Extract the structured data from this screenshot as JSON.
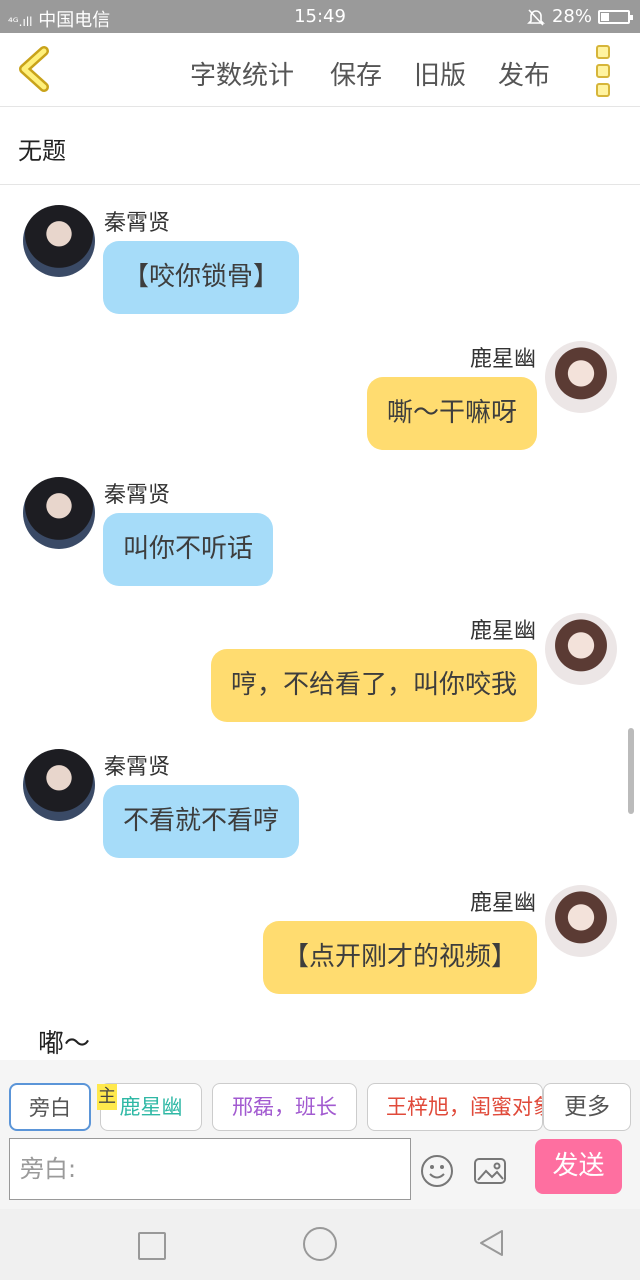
{
  "status_bar": {
    "carrier": "中国电信",
    "signal": "⁴ᴳ.ıll",
    "time": "15:49",
    "battery": "28%"
  },
  "toolbar": {
    "word_count": "字数统计",
    "save": "保存",
    "old_version": "旧版",
    "publish": "发布"
  },
  "title": "无题",
  "messages": [
    {
      "sender": "秦霄贤",
      "text": "【咬你锁骨】",
      "side": "left"
    },
    {
      "sender": "鹿星幽",
      "text": "嘶～干嘛呀",
      "side": "right"
    },
    {
      "sender": "秦霄贤",
      "text": "叫你不听话",
      "side": "left"
    },
    {
      "sender": "鹿星幽",
      "text": "哼，不给看了，叫你咬我",
      "side": "right"
    },
    {
      "sender": "秦霄贤",
      "text": "不看就不看哼",
      "side": "left"
    },
    {
      "sender": "鹿星幽",
      "text": "【点开刚才的视频】",
      "side": "right"
    }
  ],
  "narration": "嘟～",
  "roles": {
    "narrator": "旁白",
    "main_badge": "主",
    "role1": "鹿星幽",
    "role2": "邢磊，班长",
    "role3": "王梓旭，闺蜜对象",
    "more": "更多"
  },
  "input": {
    "placeholder": "旁白:"
  },
  "send": "发送",
  "colors": {
    "left_bubble": "#a6dcf9",
    "right_bubble": "#ffdc70",
    "send_button": "#fe6fa0",
    "role1": "#2fb8a5",
    "role2": "#a25ad0",
    "role3": "#e04a3a"
  }
}
